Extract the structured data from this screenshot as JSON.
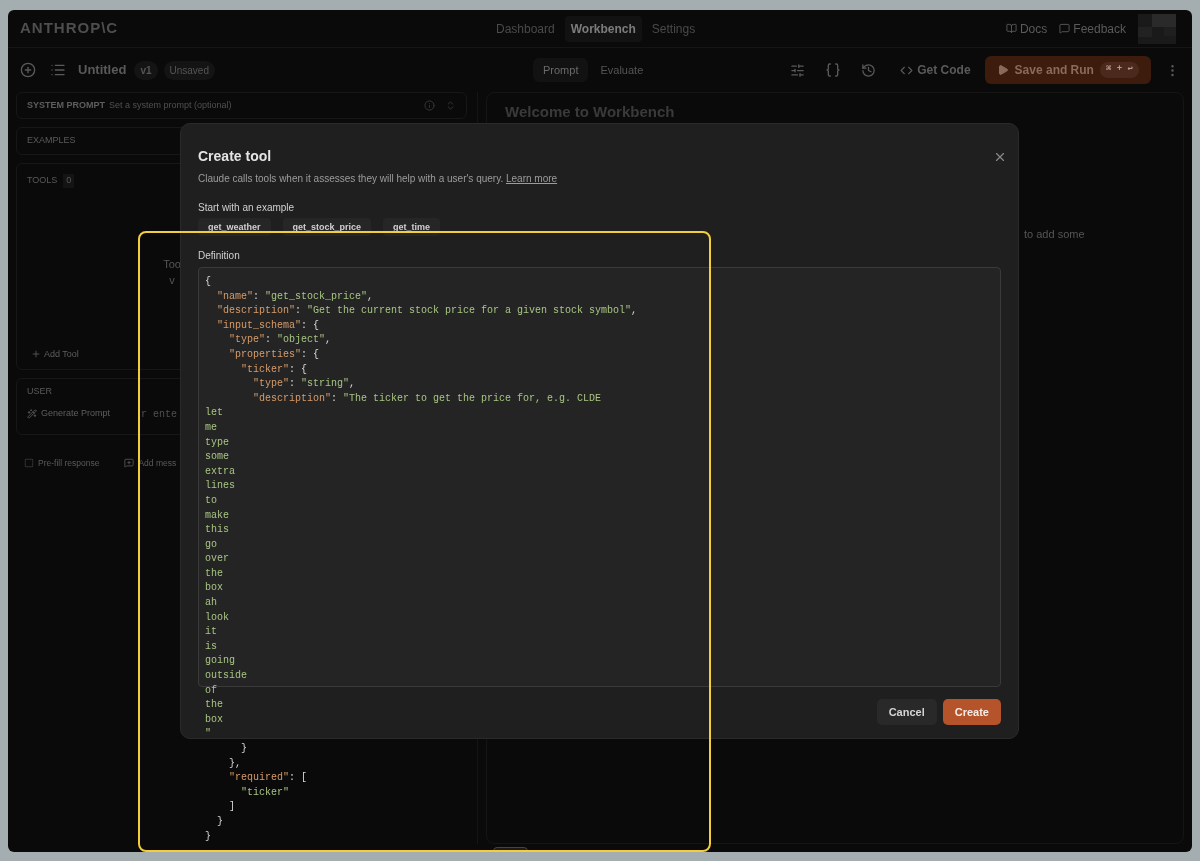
{
  "window": {
    "logo": "ANTHROP\\C",
    "nav": [
      {
        "label": "Dashboard",
        "selected": false
      },
      {
        "label": "Workbench",
        "selected": true
      },
      {
        "label": "Settings",
        "selected": false
      }
    ],
    "links": [
      "Docs",
      "Feedback"
    ]
  },
  "toolbar": {
    "title": "Untitled",
    "version": "v1",
    "status": "Unsaved",
    "tabs": [
      {
        "label": "Prompt",
        "selected": true
      },
      {
        "label": "Evaluate",
        "selected": false
      }
    ],
    "get_code": "Get Code",
    "run": {
      "label": "Save and Run",
      "shortcut": "⌘ + ↩"
    }
  },
  "left_panel": {
    "system_prompt": {
      "label": "SYSTEM PROMPT",
      "placeholder": "Set a system prompt (optional)"
    },
    "examples": {
      "label": "EXAMPLES"
    },
    "tools": {
      "label": "TOOLS",
      "count": "0",
      "empty_text": [
        "Too",
        "v"
      ],
      "add": "Add Tool"
    },
    "user": {
      "label": "USER",
      "generate": "Generate Prompt",
      "placeholder": "r ente"
    },
    "actions": [
      "Pre-fill response",
      "Add mess"
    ]
  },
  "right_panel": {
    "heading": "Welcome to Workbench",
    "text": "to add some"
  },
  "dialog": {
    "title": "Create tool",
    "description": "Claude calls tools when it assesses they will help with a user's query.",
    "link": "Learn more",
    "examples_label": "Start with an example",
    "examples": [
      "get_weather",
      "get_stock_price",
      "get_time"
    ],
    "definition_label": "Definition",
    "definition": [
      "{",
      "  \"name\": \"get_stock_price\",",
      "  \"description\": \"Get the current stock price for a given stock symbol\",",
      "  \"input_schema\": {",
      "    \"type\": \"object\",",
      "    \"properties\": {",
      "      \"ticker\": {",
      "        \"type\": \"string\",",
      "        \"description\": \"The ticker to get the price for, e.g. CLDE",
      "let",
      "me",
      "type",
      "some",
      "extra",
      "lines",
      "to",
      "make",
      "this",
      "go",
      "over",
      "the",
      "box",
      "ah",
      "look",
      "it",
      "is",
      "going",
      "outside",
      "of",
      "the",
      "box",
      "\"",
      "      }",
      "    },",
      "    \"required\": [",
      "      \"ticker\"",
      "    ]",
      "  }",
      "}"
    ],
    "buttons": [
      {
        "label": "Cancel",
        "kind": "secondary"
      },
      {
        "label": "Create",
        "kind": "primary"
      }
    ]
  }
}
